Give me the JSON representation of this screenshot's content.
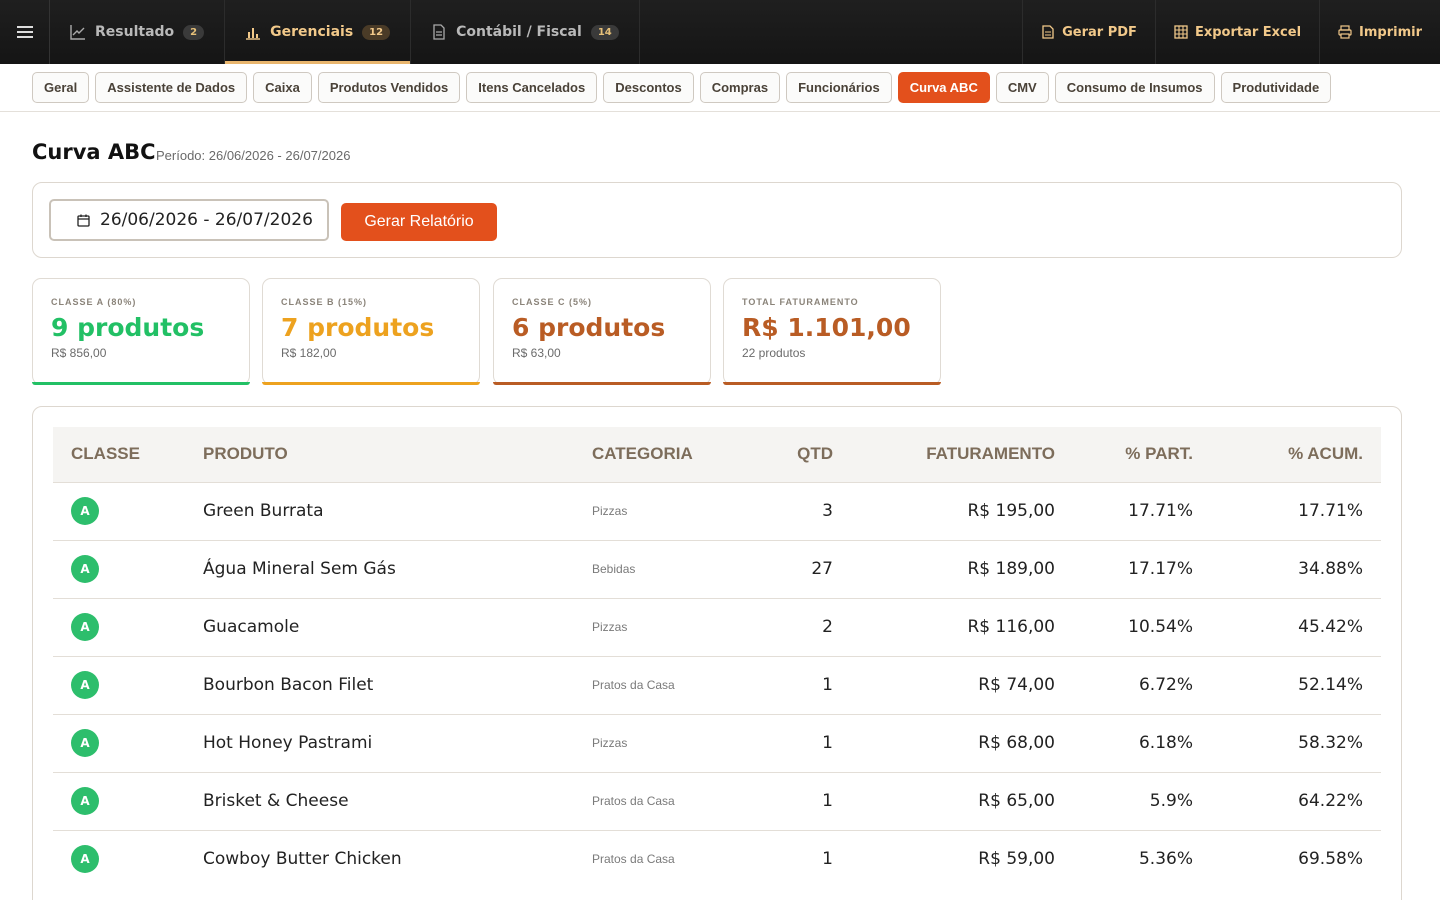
{
  "topbar": {
    "tabs": [
      {
        "label": "Resultado",
        "count": "2"
      },
      {
        "label": "Gerenciais",
        "count": "12"
      },
      {
        "label": "Contábil / Fiscal",
        "count": "14"
      }
    ],
    "actions": {
      "pdf": "Gerar PDF",
      "excel": "Exportar Excel",
      "print": "Imprimir"
    }
  },
  "subtabs": [
    "Geral",
    "Assistente de Dados",
    "Caixa",
    "Produtos Vendidos",
    "Itens Cancelados",
    "Descontos",
    "Compras",
    "Funcionários",
    "Curva ABC",
    "CMV",
    "Consumo de Insumos",
    "Produtividade"
  ],
  "page": {
    "title": "Curva ABC",
    "period": "Período: 26/06/2026 - 26/07/2026"
  },
  "filter": {
    "date_range": "26/06/2026 - 26/07/2026",
    "generate_label": "Gerar Relatório"
  },
  "summary": [
    {
      "label": "CLASSE A (80%)",
      "value": "9 produtos",
      "sub": "R$ 856,00",
      "color": "#22c065"
    },
    {
      "label": "CLASSE B (15%)",
      "value": "7 produtos",
      "sub": "R$ 182,00",
      "color": "#eda21f"
    },
    {
      "label": "CLASSE C (5%)",
      "value": "6 produtos",
      "sub": "R$ 63,00",
      "color": "#b95c24"
    },
    {
      "label": "TOTAL FATURAMENTO",
      "value": "R$ 1.101,00",
      "sub": "22 produtos",
      "color": "#b95c24"
    }
  ],
  "table": {
    "headers": [
      "CLASSE",
      "PRODUTO",
      "CATEGORIA",
      "QTD",
      "FATURAMENTO",
      "% PART.",
      "% ACUM."
    ],
    "rows": [
      {
        "cls": "A",
        "produto": "Green Burrata",
        "categoria": "Pizzas",
        "qtd": "3",
        "fat": "R$ 195,00",
        "part": "17.71%",
        "acum": "17.71%"
      },
      {
        "cls": "A",
        "produto": "Água Mineral Sem Gás",
        "categoria": "Bebidas",
        "qtd": "27",
        "fat": "R$ 189,00",
        "part": "17.17%",
        "acum": "34.88%"
      },
      {
        "cls": "A",
        "produto": "Guacamole",
        "categoria": "Pizzas",
        "qtd": "2",
        "fat": "R$ 116,00",
        "part": "10.54%",
        "acum": "45.42%"
      },
      {
        "cls": "A",
        "produto": "Bourbon Bacon Filet",
        "categoria": "Pratos da Casa",
        "qtd": "1",
        "fat": "R$ 74,00",
        "part": "6.72%",
        "acum": "52.14%"
      },
      {
        "cls": "A",
        "produto": "Hot Honey Pastrami",
        "categoria": "Pizzas",
        "qtd": "1",
        "fat": "R$ 68,00",
        "part": "6.18%",
        "acum": "58.32%"
      },
      {
        "cls": "A",
        "produto": "Brisket & Cheese",
        "categoria": "Pratos da Casa",
        "qtd": "1",
        "fat": "R$ 65,00",
        "part": "5.9%",
        "acum": "64.22%"
      },
      {
        "cls": "A",
        "produto": "Cowboy Butter Chicken",
        "categoria": "Pratos da Casa",
        "qtd": "1",
        "fat": "R$ 59,00",
        "part": "5.36%",
        "acum": "69.58%"
      }
    ]
  }
}
